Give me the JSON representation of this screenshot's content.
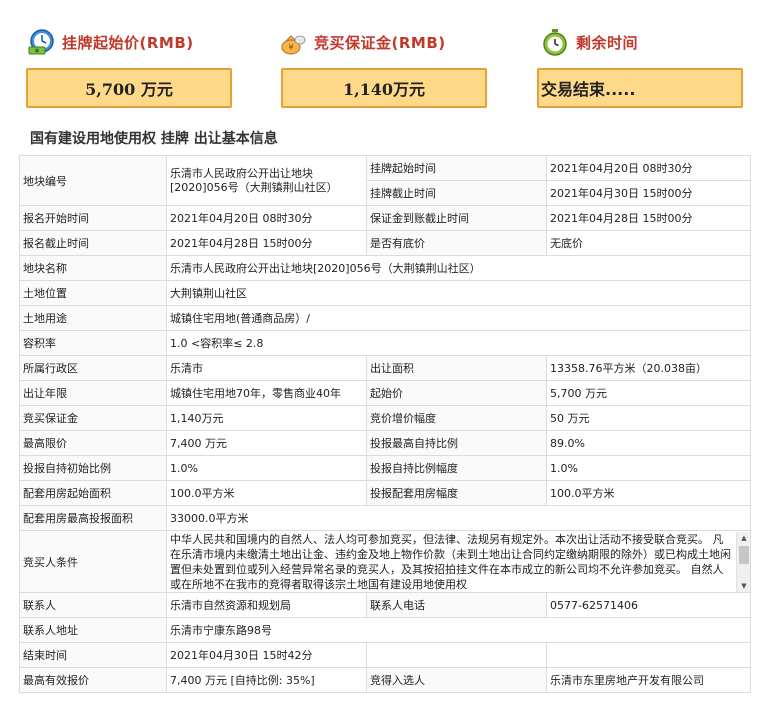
{
  "header": {
    "price_label": "挂牌起始价(RMB)",
    "deposit_label": "竞买保证金(RMB)",
    "time_label": "剩余时间",
    "price_value": "5,700 万元",
    "deposit_value": "1,140万元",
    "time_value": "交易结束.....",
    "icons": [
      "clock-money-icon",
      "deposit-bag-icon",
      "timer-icon"
    ]
  },
  "section_title": "国有建设用地使用权 挂牌 出让基本信息",
  "table": {
    "plot_no_label": "地块编号",
    "plot_no_value": "乐清市人民政府公开出让地块[2020]056号（大荆镇荆山社区）",
    "listing_start_label": "挂牌起始时间",
    "listing_start_value": "2021年04月20日 08时30分",
    "listing_end_label": "挂牌截止时间",
    "listing_end_value": "2021年04月30日 15时00分",
    "reg_start_label": "报名开始时间",
    "reg_start_value": "2021年04月20日 08时30分",
    "deposit_deadline_label": "保证金到账截止时间",
    "deposit_deadline_value": "2021年04月28日 15时00分",
    "reg_end_label": "报名截止时间",
    "reg_end_value": "2021年04月28日 15时00分",
    "reserve_label": "是否有底价",
    "reserve_value": "无底价",
    "plot_name_label": "地块名称",
    "plot_name_value": "乐清市人民政府公开出让地块[2020]056号（大荆镇荆山社区）",
    "location_label": "土地位置",
    "location_value": "大荆镇荆山社区",
    "usage_label": "土地用途",
    "usage_value": "城镇住宅用地(普通商品房）/",
    "far_label": "容积率",
    "far_value": "1.0 <容积率≤ 2.8",
    "district_label": "所属行政区",
    "district_value": "乐清市",
    "area_label": "出让面积",
    "area_value": "13358.76平方米（20.038亩）",
    "term_label": "出让年限",
    "term_value": "城镇住宅用地70年，零售商业40年",
    "start_price_label": "起始价",
    "start_price_value": "5,700 万元",
    "bid_deposit_label": "竞买保证金",
    "bid_deposit_value": "1,140万元",
    "increment_label": "竞价增价幅度",
    "increment_value": "50 万元",
    "max_price_label": "最高限价",
    "max_price_value": "7,400 万元",
    "max_self_ratio_label": "投报最高自持比例",
    "max_self_ratio_value": "89.0%",
    "init_self_ratio_label": "投报自持初始比例",
    "init_self_ratio_value": "1.0%",
    "self_ratio_step_label": "投报自持比例幅度",
    "self_ratio_step_value": "1.0%",
    "housing_start_label": "配套用房起始面积",
    "housing_start_value": "100.0平方米",
    "housing_step_label": "投报配套用房幅度",
    "housing_step_value": "100.0平方米",
    "housing_max_label": "配套用房最高投报面积",
    "housing_max_value": "33000.0平方米",
    "conditions_label": "竞买人条件",
    "conditions_value": "中华人民共和国境内的自然人、法人均可参加竞买，但法律、法规另有规定外。本次出让活动不接受联合竞买。 凡在乐清市境内未缴清土地出让金、违约金及地上物作价款（未到土地出让合同约定缴纳期限的除外）或已构成土地闲置但未处置到位或列入经营异常名录的竞买人，及其按招拍挂文件在本市成立的新公司均不允许参加竞买。 自然人或在所地不在我市的竞得者取得该宗土地国有建设用地使用权",
    "contact_label": "联系人",
    "contact_value": "乐清市自然资源和规划局",
    "phone_label": "联系人电话",
    "phone_value": "0577-62571406",
    "address_label": "联系人地址",
    "address_value": "乐清市宁康东路98号",
    "end_time_label": "结束时间",
    "end_time_value": "2021年04月30日 15时42分",
    "top_bid_label": "最高有效报价",
    "top_bid_value": "7,400 万元 [自持比例: 35%]",
    "winner_label": "竞得入选人",
    "winner_value": "乐清市东里房地产开发有限公司"
  }
}
